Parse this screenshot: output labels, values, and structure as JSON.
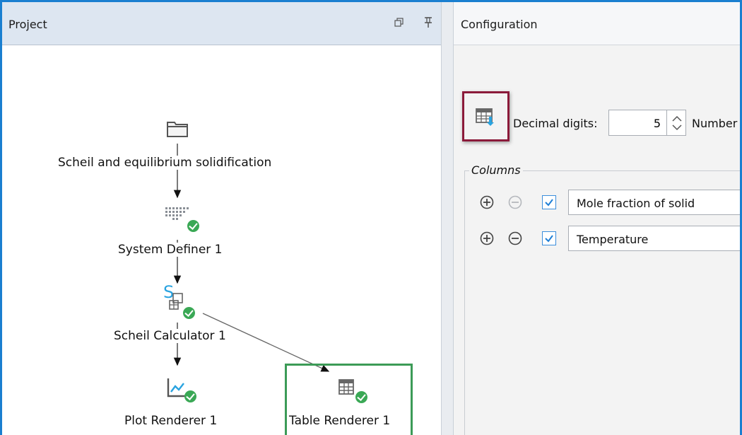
{
  "project_panel": {
    "title": "Project",
    "restore_icon": "restore-window-icon",
    "pin_icon": "pin-icon",
    "tree": {
      "root": {
        "label": "Scheil and equilibrium solidification",
        "icon": "folder-icon"
      },
      "system_definer": {
        "label": "System Definer 1",
        "icon": "system-definer-icon",
        "status": "ok"
      },
      "scheil_calculator": {
        "label": "Scheil Calculator 1",
        "icon": "scheil-calculator-icon",
        "status": "ok"
      },
      "plot_renderer": {
        "label": "Plot Renderer 1",
        "icon": "plot-renderer-icon",
        "status": "ok"
      },
      "table_renderer": {
        "label": "Table Renderer 1",
        "icon": "table-renderer-icon",
        "status": "ok",
        "selected": true
      }
    }
  },
  "config_panel": {
    "title": "Configuration",
    "export_icon": "table-export-icon",
    "decimal_digits_label": "Decimal digits:",
    "decimal_digits_value": "5",
    "number_label": "Number",
    "columns_legend": "Columns",
    "columns": [
      {
        "name": "Mole fraction of solid",
        "checked": true,
        "remove_enabled": false
      },
      {
        "name": "Temperature",
        "checked": true,
        "remove_enabled": true
      }
    ]
  },
  "colors": {
    "frame_border": "#1a7fd0",
    "highlight_export": "#8b1a3a",
    "selected_node": "#3c9b57",
    "ok_status": "#3aa855",
    "calculator_accent": "#29a3e0"
  }
}
